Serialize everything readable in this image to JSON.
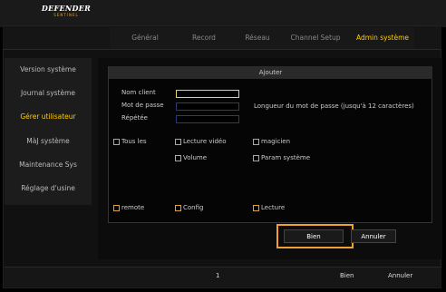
{
  "brand": {
    "name": "DEFENDER",
    "tagline": "SENTINEL"
  },
  "tabs": [
    {
      "label": "Général",
      "active": false
    },
    {
      "label": "Record",
      "active": false
    },
    {
      "label": "Réseau",
      "active": false
    },
    {
      "label": "Channel Setup",
      "active": false
    },
    {
      "label": "Admin système",
      "active": true
    }
  ],
  "sidebar": {
    "items": [
      {
        "label": "Version système",
        "active": false
      },
      {
        "label": "Journal système",
        "active": false
      },
      {
        "label": "Gérer utilisateur",
        "active": true
      },
      {
        "label": "MàJ système",
        "active": false
      },
      {
        "label": "Maintenance Sys",
        "active": false
      },
      {
        "label": "Réglage d'usine",
        "active": false
      }
    ]
  },
  "dialog": {
    "title": "Ajouter",
    "fields": {
      "client_label": "Nom client",
      "client_value": "",
      "password_label": "Mot de passe",
      "password_value": "",
      "repeat_label": "Répétée",
      "repeat_value": "",
      "password_hint": "Longueur du mot de passe (jusqu'à 12 caractères)"
    },
    "permissions": {
      "all": {
        "label": "Tous les",
        "checked": false
      },
      "video_playback": {
        "label": "Lecture vidéo",
        "checked": false
      },
      "wizard": {
        "label": "magicien",
        "checked": false
      },
      "volume": {
        "label": "Volume",
        "checked": false
      },
      "system_params": {
        "label": "Param système",
        "checked": false
      },
      "remote": {
        "label": "remote",
        "checked": false
      },
      "config": {
        "label": "Config",
        "checked": false
      },
      "playback": {
        "label": "Lecture",
        "checked": false
      }
    },
    "ok_label": "Bien",
    "cancel_label": "Annuler"
  },
  "footer": {
    "page_number": "1",
    "ok_label": "Bien",
    "cancel_label": "Annuler"
  },
  "colors": {
    "accent_yellow": "#ffcc00",
    "highlight_orange": "#f0a030",
    "field_border": "#2a3a7a"
  }
}
